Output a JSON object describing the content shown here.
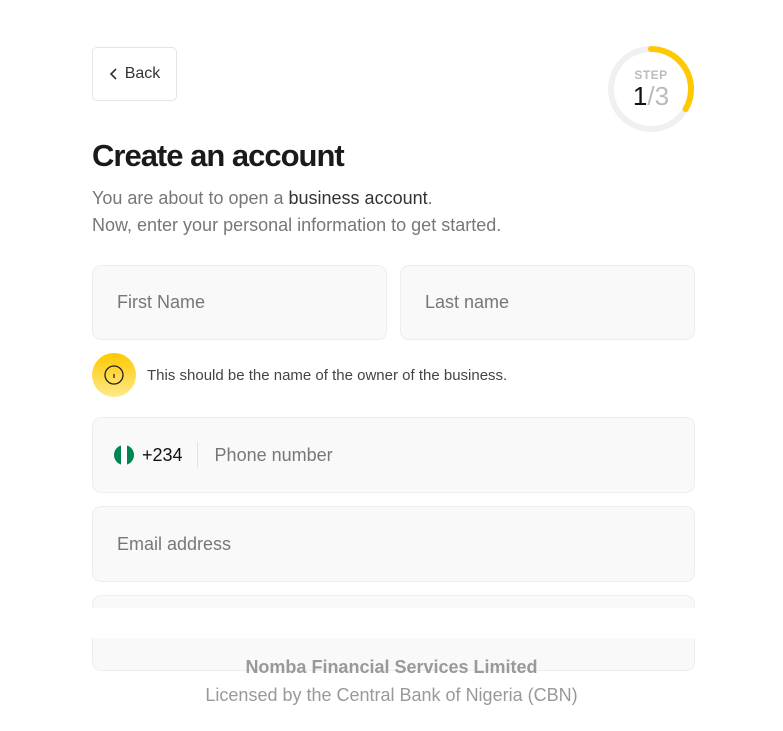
{
  "back_label": "Back",
  "progress": {
    "label": "STEP",
    "current": "1",
    "total": "/3",
    "fraction": 0.3333,
    "accent": "#FFC800",
    "track": "#F0F0F0"
  },
  "title": "Create an account",
  "subtitle": {
    "pre": "You are about to open a ",
    "highlight": "business account",
    "post": ".",
    "line2": "Now, enter your personal information to get started."
  },
  "form": {
    "first_name_placeholder": "First Name",
    "last_name_placeholder": "Last name",
    "hint": "This should be the name of the owner of the business.",
    "country_code": "+234",
    "phone_placeholder": "Phone number",
    "email_placeholder": "Email address"
  },
  "footer": {
    "company": "Nomba Financial Services Limited",
    "license": "Licensed by the Central Bank of Nigeria (CBN)"
  }
}
